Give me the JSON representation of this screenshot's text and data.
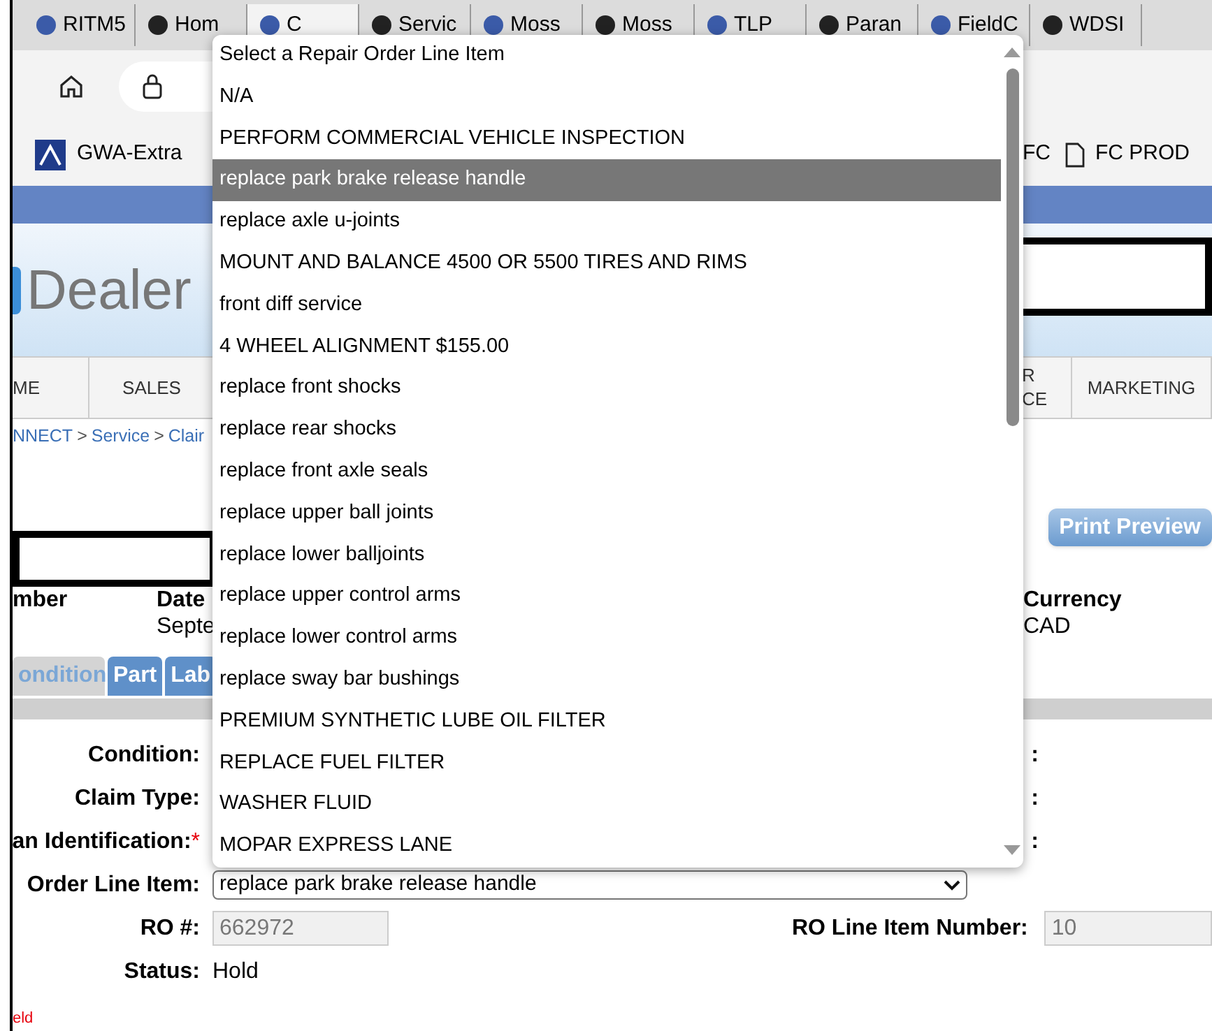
{
  "browser_tabs": [
    {
      "label": "RITM5",
      "selected": false
    },
    {
      "label": "Hom",
      "selected": false
    },
    {
      "label": "C",
      "selected": true
    },
    {
      "label": "Servic",
      "selected": false
    },
    {
      "label": "Moss",
      "selected": false
    },
    {
      "label": "Moss",
      "selected": false
    },
    {
      "label": "TLP",
      "selected": false
    },
    {
      "label": "Paran",
      "selected": false
    },
    {
      "label": "FieldC",
      "selected": false
    },
    {
      "label": "WDSI",
      "selected": false
    }
  ],
  "bookmarks": [
    {
      "label": "GWA-Extra"
    },
    {
      "label": "FC"
    },
    {
      "label": "FC PROD"
    }
  ],
  "logo": "Dealer",
  "nav": [
    {
      "lines": [
        "ME"
      ]
    },
    {
      "lines": [
        "SALES"
      ]
    },
    {
      "lines": [
        "R",
        "CE"
      ]
    },
    {
      "lines": [
        "MARKETING"
      ]
    }
  ],
  "breadcrumb": [
    {
      "kind": "link",
      "text": "NNECT"
    },
    {
      "kind": "sep",
      "text": ">"
    },
    {
      "kind": "link",
      "text": "Service"
    },
    {
      "kind": "sep",
      "text": ">"
    },
    {
      "kind": "link",
      "text": "Clair"
    }
  ],
  "print_button": "Print Preview",
  "header_fields": [
    {
      "label": "mber"
    },
    {
      "label": "Date",
      "value": "Septe"
    },
    {
      "label": "Currency",
      "value": "CAD"
    }
  ],
  "detail_tabs": [
    {
      "label": "ondition",
      "selected": true
    },
    {
      "label": "Part",
      "selected": false
    },
    {
      "label": "Lab",
      "selected": false
    }
  ],
  "form": [
    {
      "label": "Condition:",
      "right_label": ":"
    },
    {
      "label": "Claim Type:",
      "right_label": ":"
    },
    {
      "label": "an Identification:",
      "required_mark": "*",
      "right_label": ":"
    },
    {
      "label": "Order Line Item:",
      "kind": "select",
      "value": "replace park brake release handle"
    },
    {
      "label": "RO #:",
      "kind": "input",
      "value": "662972",
      "right_label": "RO Line Item Number:",
      "right_value": "10"
    },
    {
      "label": "Status:",
      "kind": "text",
      "value": "Hold"
    }
  ],
  "footnote": "eld",
  "dropdown": [
    {
      "label": "Select a Repair Order Line Item",
      "selected": false
    },
    {
      "label": "N/A",
      "selected": false
    },
    {
      "label": "PERFORM COMMERCIAL VEHICLE INSPECTION",
      "selected": false
    },
    {
      "label": "replace park brake release handle",
      "selected": true
    },
    {
      "label": "replace axle u-joints",
      "selected": false
    },
    {
      "label": "MOUNT AND BALANCE 4500 OR 5500 TIRES AND RIMS",
      "selected": false
    },
    {
      "label": "front diff service",
      "selected": false
    },
    {
      "label": "4 WHEEL ALIGNMENT $155.00",
      "selected": false
    },
    {
      "label": "replace front shocks",
      "selected": false
    },
    {
      "label": "replace rear shocks",
      "selected": false
    },
    {
      "label": "replace front axle seals",
      "selected": false
    },
    {
      "label": "replace upper ball joints",
      "selected": false
    },
    {
      "label": "replace lower balljoints",
      "selected": false
    },
    {
      "label": "replace upper control arms",
      "selected": false
    },
    {
      "label": "replace lower control arms",
      "selected": false
    },
    {
      "label": "replace sway bar bushings",
      "selected": false
    },
    {
      "label": "PREMIUM SYNTHETIC LUBE OIL FILTER",
      "selected": false
    },
    {
      "label": "REPLACE FUEL FILTER",
      "selected": false
    },
    {
      "label": "WASHER FLUID",
      "selected": false
    },
    {
      "label": "MOPAR EXPRESS LANE",
      "selected": false
    }
  ]
}
